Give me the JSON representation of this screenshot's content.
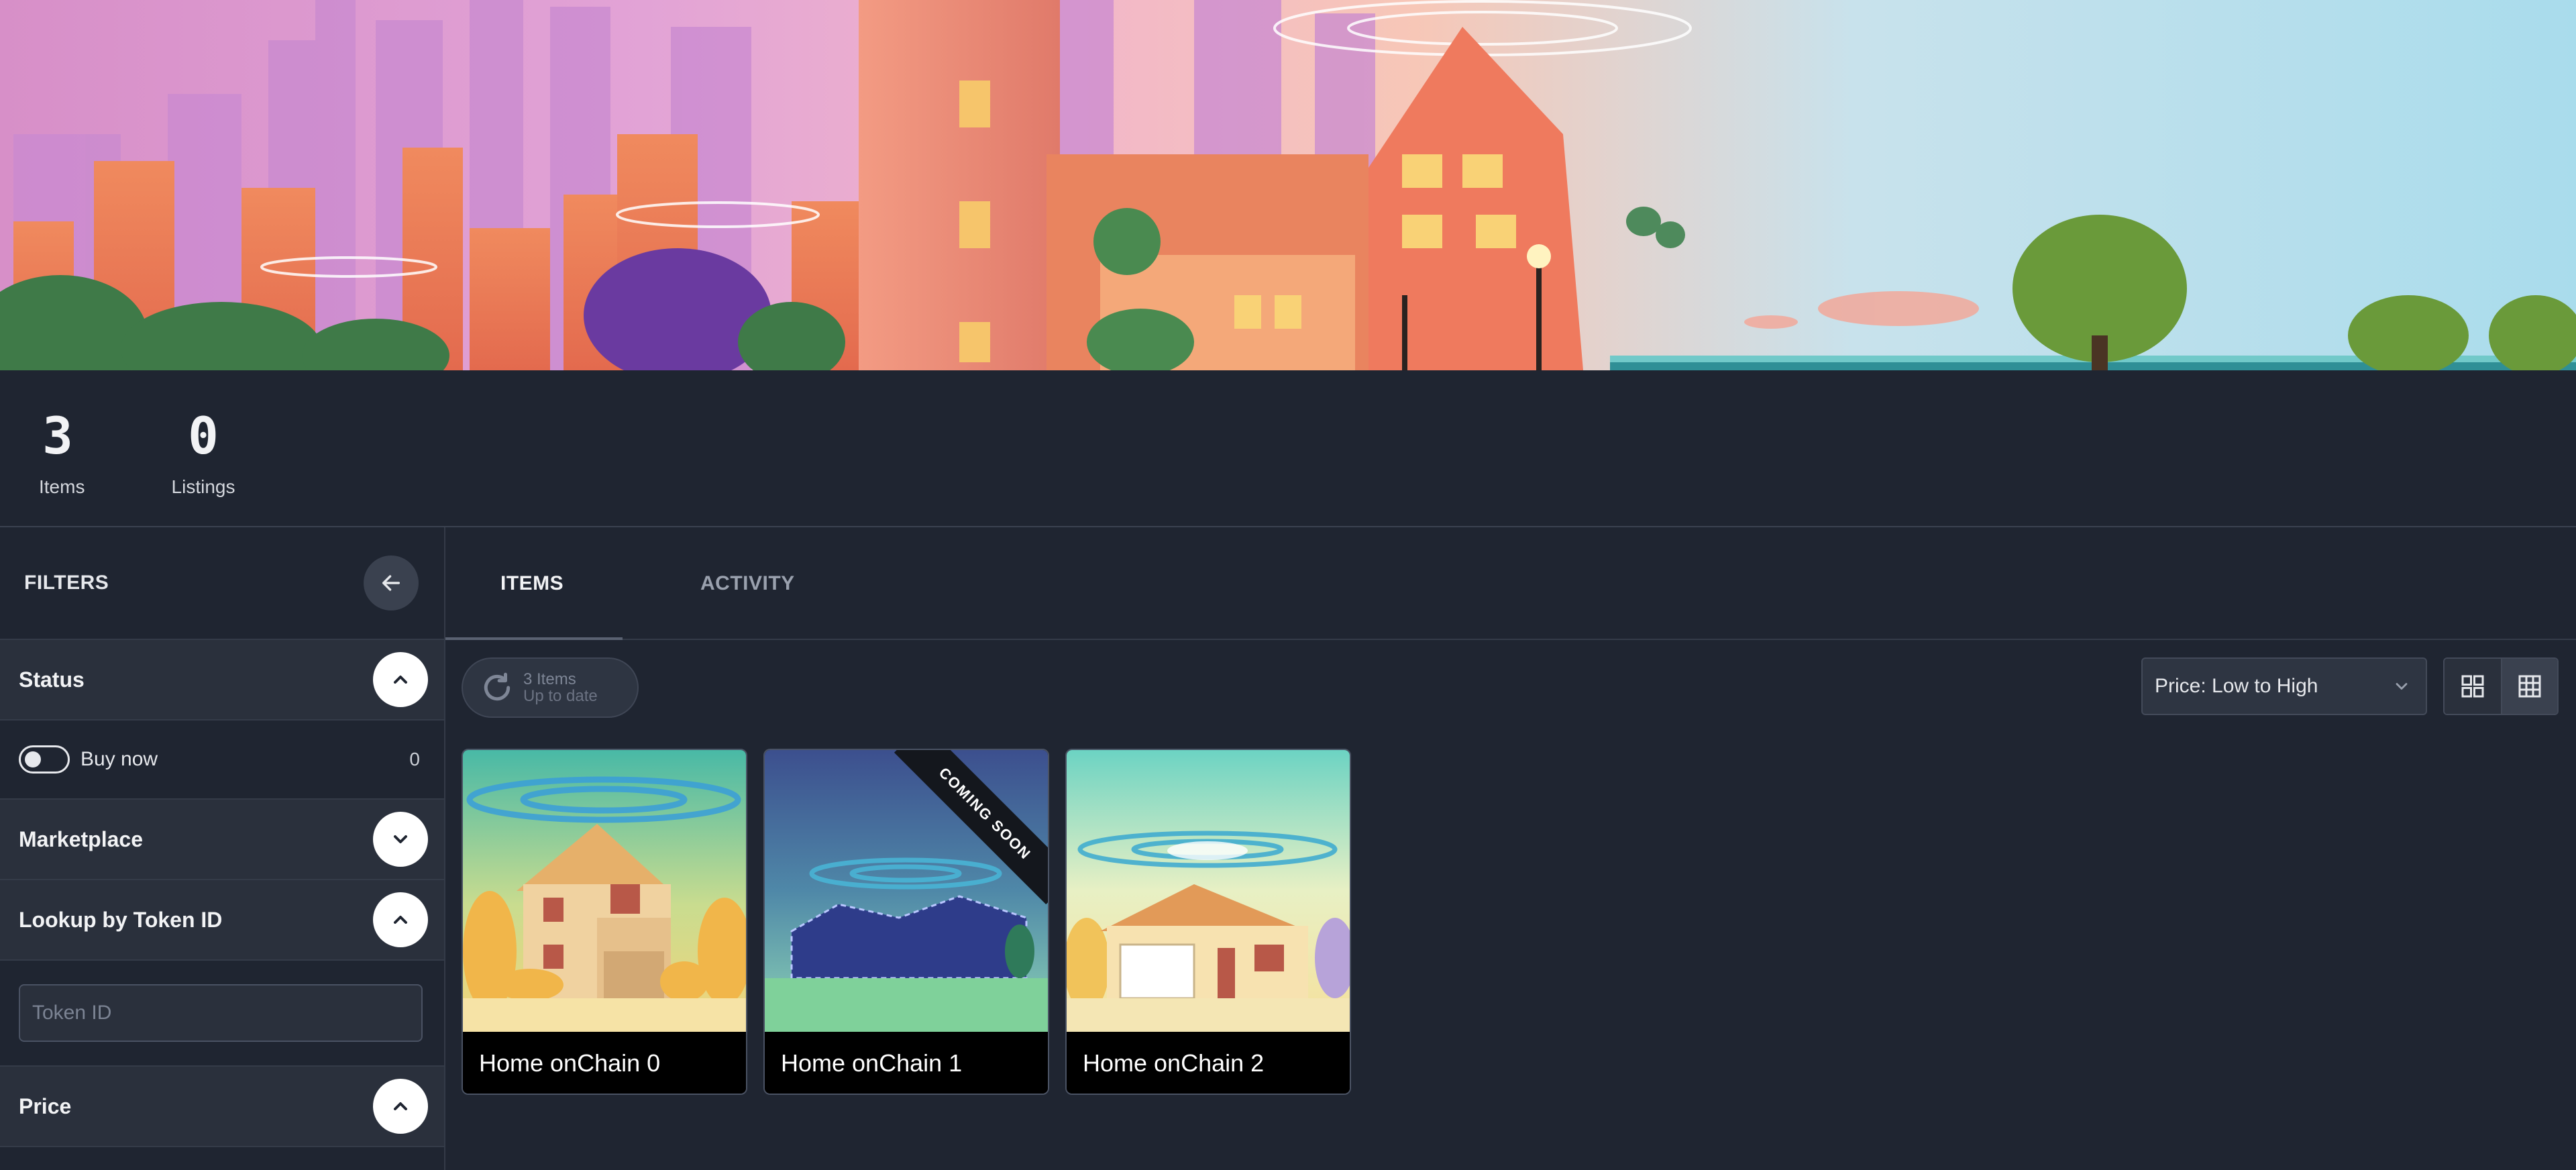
{
  "stats": {
    "items": {
      "value": "3",
      "label": "Items"
    },
    "listings": {
      "value": "0",
      "label": "Listings"
    }
  },
  "filters": {
    "title": "FILTERS",
    "status": {
      "title": "Status",
      "buy_now_label": "Buy now",
      "buy_now_count": "0"
    },
    "marketplace": {
      "title": "Marketplace"
    },
    "lookup": {
      "title": "Lookup by Token ID",
      "placeholder": "Token ID"
    },
    "price": {
      "title": "Price"
    }
  },
  "tabs": {
    "items": "ITEMS",
    "activity": "ACTIVITY"
  },
  "toolbar": {
    "refresh_line1": "3 Items",
    "refresh_line2": "Up to date",
    "sort_selected": "Price: Low to High"
  },
  "cards": [
    {
      "name": "Home onChain 0"
    },
    {
      "name": "Home onChain 1",
      "ribbon": "COMING SOON"
    },
    {
      "name": "Home onChain 2"
    }
  ]
}
